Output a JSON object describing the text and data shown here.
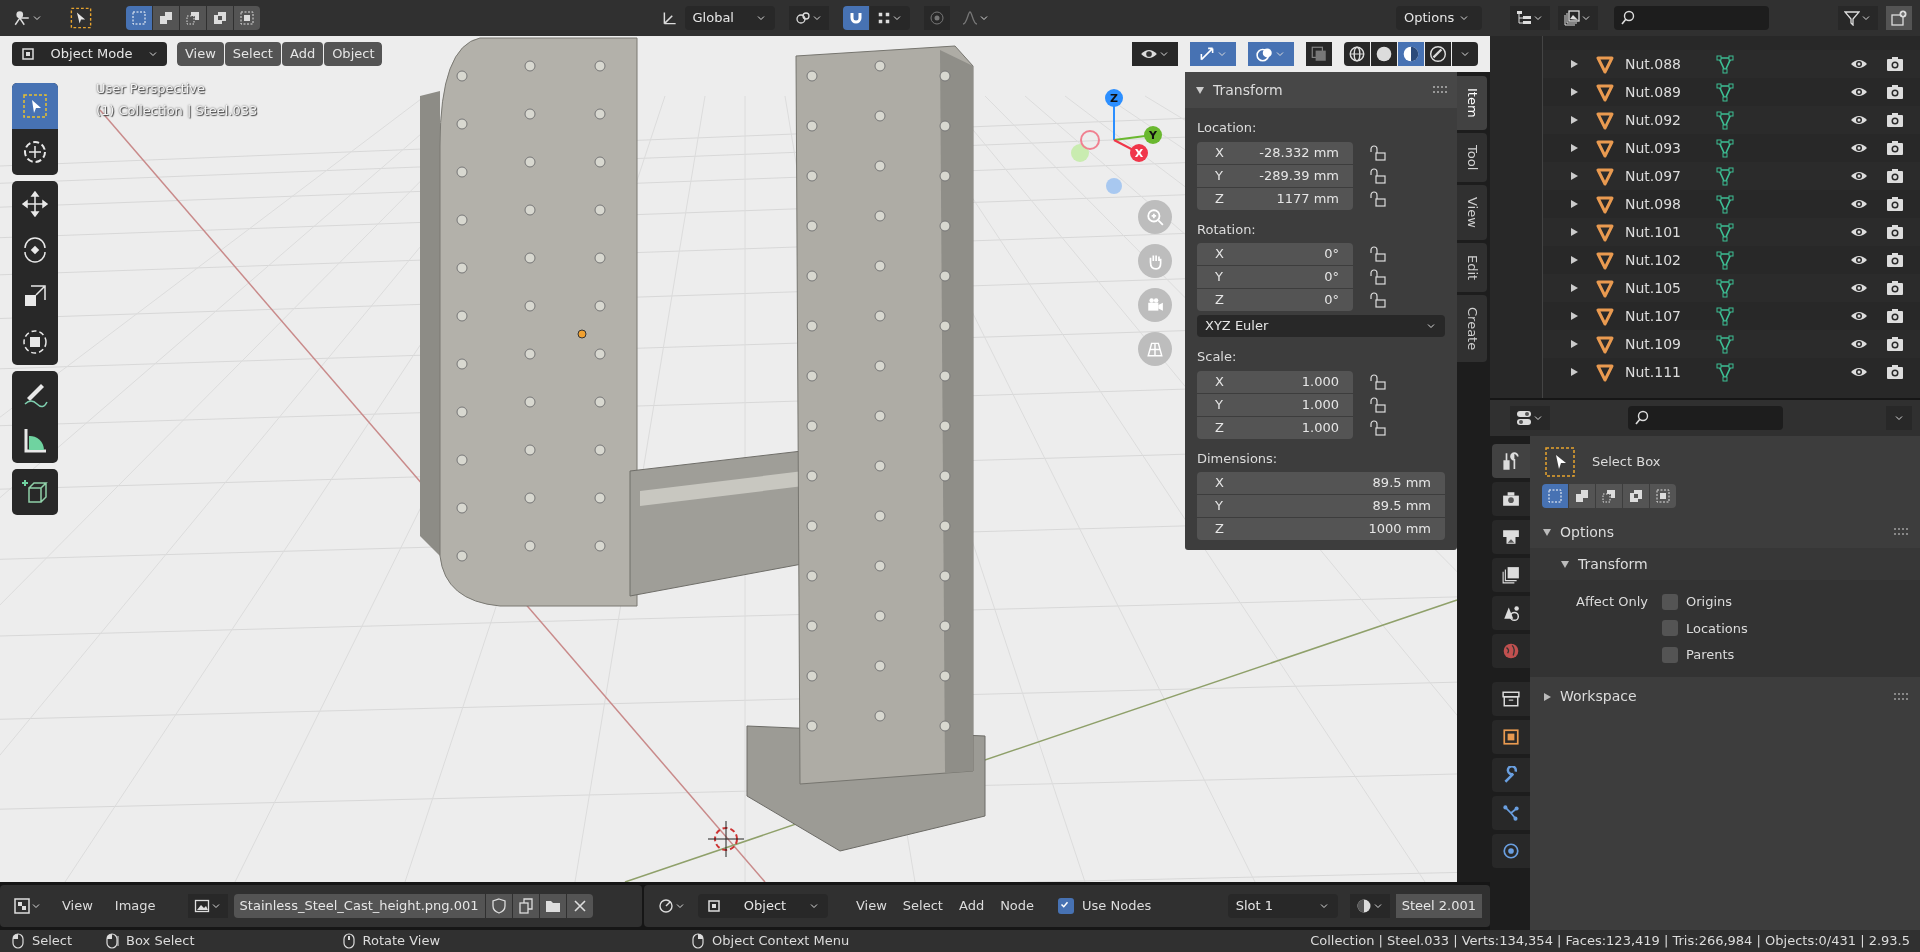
{
  "top_header": {
    "select_modes": [
      {
        "kind": "set",
        "selected": true
      },
      {
        "kind": "extend",
        "selected": false
      },
      {
        "kind": "subtract",
        "selected": false
      },
      {
        "kind": "invert",
        "selected": false
      },
      {
        "kind": "intersect",
        "selected": false
      }
    ],
    "orientation": "Global",
    "snap_on": true,
    "proportional_on": false,
    "options": "Options"
  },
  "viewport_header": {
    "mode": "Object Mode",
    "menus": [
      "View",
      "Select",
      "Add",
      "Object"
    ],
    "toggles": [
      {
        "kind": "visibility",
        "on": false
      },
      {
        "kind": "gizmos",
        "on": true
      },
      {
        "kind": "overlays",
        "on": true
      },
      {
        "kind": "xray",
        "on": false
      }
    ],
    "shading": [
      {
        "kind": "wireframe",
        "selected": false
      },
      {
        "kind": "solid",
        "selected": false
      },
      {
        "kind": "material",
        "selected": true
      },
      {
        "kind": "rendered",
        "selected": false
      }
    ]
  },
  "viewport_text": [
    "User Perspective",
    "(1) Collection | Steel.033"
  ],
  "toolbar": [
    [
      {
        "kind": "select-box",
        "selected": true
      },
      {
        "kind": "cursor",
        "selected": false
      }
    ],
    [
      {
        "kind": "move",
        "selected": false
      },
      {
        "kind": "rotate",
        "selected": false
      },
      {
        "kind": "scale",
        "selected": false
      },
      {
        "kind": "transform",
        "selected": false
      }
    ],
    [
      {
        "kind": "annotate",
        "selected": false
      },
      {
        "kind": "measure",
        "selected": false
      }
    ],
    [
      {
        "kind": "add-cube",
        "selected": false
      }
    ]
  ],
  "gizmo_axes": [
    "Z",
    "Y",
    "X"
  ],
  "transform_panel": {
    "title": "Transform",
    "sections": [
      {
        "label": "Location:",
        "fields": [
          {
            "axis": "X",
            "value": "-28.332 mm",
            "locked": false
          },
          {
            "axis": "Y",
            "value": "-289.39 mm",
            "locked": false
          },
          {
            "axis": "Z",
            "value": "1177 mm",
            "locked": false
          }
        ]
      },
      {
        "label": "Rotation:",
        "fields": [
          {
            "axis": "X",
            "value": "0°",
            "locked": false
          },
          {
            "axis": "Y",
            "value": "0°",
            "locked": false
          },
          {
            "axis": "Z",
            "value": "0°",
            "locked": false
          }
        ],
        "mode": "XYZ Euler"
      },
      {
        "label": "Scale:",
        "fields": [
          {
            "axis": "X",
            "value": "1.000",
            "locked": false
          },
          {
            "axis": "Y",
            "value": "1.000",
            "locked": false
          },
          {
            "axis": "Z",
            "value": "1.000",
            "locked": false
          }
        ]
      },
      {
        "label": "Dimensions:",
        "fields": [
          {
            "axis": "X",
            "value": "89.5 mm"
          },
          {
            "axis": "Y",
            "value": "89.5 mm"
          },
          {
            "axis": "Z",
            "value": "1000 mm"
          }
        ]
      }
    ]
  },
  "sidebar_tabs": [
    {
      "label": "Item",
      "selected": true
    },
    {
      "label": "Tool",
      "selected": false
    },
    {
      "label": "View",
      "selected": false
    },
    {
      "label": "Edit",
      "selected": false
    },
    {
      "label": "Create",
      "selected": false
    }
  ],
  "outliner": {
    "rows": [
      {
        "name": "Nut.088",
        "expanded": false
      },
      {
        "name": "Nut.089",
        "expanded": false
      },
      {
        "name": "Nut.092",
        "expanded": false
      },
      {
        "name": "Nut.093",
        "expanded": false
      },
      {
        "name": "Nut.097",
        "expanded": false
      },
      {
        "name": "Nut.098",
        "expanded": false
      },
      {
        "name": "Nut.101",
        "expanded": false
      },
      {
        "name": "Nut.102",
        "expanded": false
      },
      {
        "name": "Nut.105",
        "expanded": false
      },
      {
        "name": "Nut.107",
        "expanded": false
      },
      {
        "name": "Nut.109",
        "expanded": false
      },
      {
        "name": "Nut.111",
        "expanded": false
      }
    ]
  },
  "properties": {
    "tabs": [
      {
        "kind": "tool",
        "selected": true
      },
      {
        "kind": "render",
        "selected": false
      },
      {
        "kind": "output",
        "selected": false
      },
      {
        "kind": "view-layer",
        "selected": false
      },
      {
        "kind": "scene",
        "selected": false
      },
      {
        "kind": "world",
        "selected": false
      },
      {
        "kind": "collection",
        "selected": false
      },
      {
        "kind": "object",
        "selected": false
      },
      {
        "kind": "modifiers",
        "selected": false
      },
      {
        "kind": "particles",
        "selected": false
      },
      {
        "kind": "physics",
        "selected": false
      }
    ],
    "tool_name": "Select Box",
    "modes": [
      {
        "kind": "set",
        "selected": true
      },
      {
        "kind": "extend",
        "selected": false
      },
      {
        "kind": "subtract",
        "selected": false
      },
      {
        "kind": "invert",
        "selected": false
      },
      {
        "kind": "intersect",
        "selected": false
      }
    ],
    "options": {
      "title": "Options",
      "expanded": true,
      "subpanel": {
        "title": "Transform",
        "expanded": true
      },
      "affect_label": "Affect Only",
      "checkboxes": [
        {
          "label": "Origins",
          "checked": false
        },
        {
          "label": "Locations",
          "checked": false
        },
        {
          "label": "Parents",
          "checked": false
        }
      ]
    },
    "workspace": {
      "title": "Workspace",
      "expanded": false
    }
  },
  "image_header": {
    "menus": [
      "View",
      "Image"
    ],
    "image_name": "Stainless_Steel_Cast_height.png.001"
  },
  "node_header": {
    "type": "Object",
    "menus": [
      "View",
      "Select",
      "Add",
      "Node"
    ],
    "use_nodes": {
      "label": "Use Nodes",
      "checked": true
    },
    "slot": "Slot 1",
    "material": "Steel 2.001"
  },
  "status_bar": {
    "hints": [
      {
        "kind": "mouse-left",
        "label": "Select"
      },
      {
        "kind": "mouse-drag",
        "label": "Box Select"
      },
      {
        "kind": "mouse-middle",
        "label": "Rotate View"
      },
      {
        "kind": "mouse-right",
        "label": "Object Context Menu"
      }
    ],
    "stats": "Collection | Steel.033 | Verts:134,354 | Faces:123,419 | Tris:266,984 | Objects:0/431 | 2.93.5"
  }
}
